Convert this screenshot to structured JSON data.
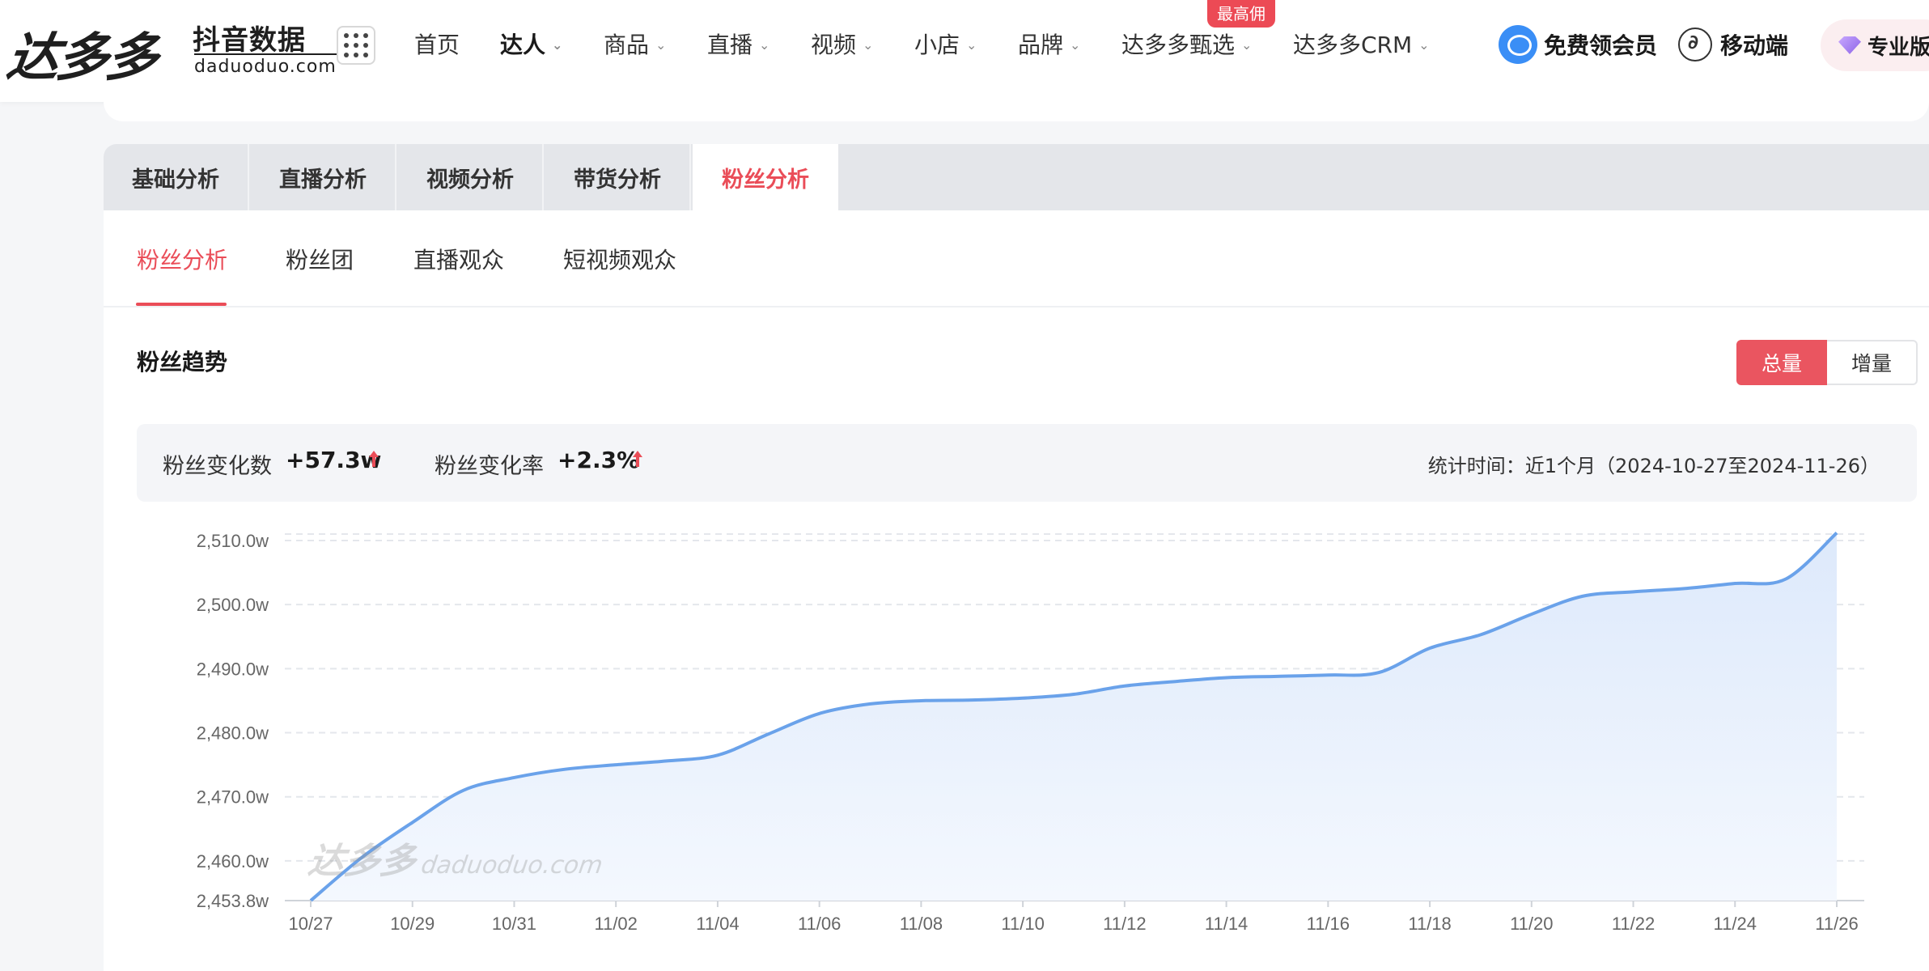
{
  "brand": {
    "logo_text": "达多多",
    "cn_sub": "抖音数据",
    "domain": "daduoduo.com"
  },
  "nav": {
    "items": [
      {
        "label": "首页",
        "dropdown": false
      },
      {
        "label": "达人",
        "dropdown": true,
        "active": true
      },
      {
        "label": "商品",
        "dropdown": true
      },
      {
        "label": "直播",
        "dropdown": true
      },
      {
        "label": "视频",
        "dropdown": true
      },
      {
        "label": "小店",
        "dropdown": true
      },
      {
        "label": "品牌",
        "dropdown": true
      },
      {
        "label": "达多多甄选",
        "dropdown": true
      },
      {
        "label": "达多多CRM",
        "dropdown": true
      }
    ],
    "badge": "最高佣",
    "vip_link": "免费领会员",
    "mobile_link": "移动端",
    "pro_label": "专业版"
  },
  "tabs": [
    {
      "label": "基础分析"
    },
    {
      "label": "直播分析"
    },
    {
      "label": "视频分析"
    },
    {
      "label": "带货分析"
    },
    {
      "label": "粉丝分析",
      "active": true
    }
  ],
  "subtabs": [
    {
      "label": "粉丝分析",
      "active": true
    },
    {
      "label": "粉丝团"
    },
    {
      "label": "直播观众"
    },
    {
      "label": "短视频观众"
    }
  ],
  "section": {
    "title": "粉丝趋势",
    "toggle_total": "总量",
    "toggle_increment": "增量",
    "selected": "总量"
  },
  "stats": {
    "change_label": "粉丝变化数",
    "change_value": "+57.3w",
    "rate_label": "粉丝变化率",
    "rate_value": "+2.3%",
    "time_label": "统计时间：近1个月（2024-10-27至2024-11-26）"
  },
  "watermark": {
    "cn": "达多多",
    "en": "daduoduo.com"
  },
  "colors": {
    "accent": "#ea4d58",
    "line": "#6aa2ea",
    "area_top": "#dde9fb",
    "area_bottom": "#f4f8fe"
  },
  "chart_data": {
    "type": "area",
    "x": [
      "10/27",
      "10/28",
      "10/29",
      "10/30",
      "10/31",
      "11/01",
      "11/02",
      "11/03",
      "11/04",
      "11/05",
      "11/06",
      "11/07",
      "11/08",
      "11/09",
      "11/10",
      "11/11",
      "11/12",
      "11/13",
      "11/14",
      "11/15",
      "11/16",
      "11/17",
      "11/18",
      "11/19",
      "11/20",
      "11/21",
      "11/22",
      "11/23",
      "11/24",
      "11/25",
      "11/26"
    ],
    "x_tick_labels": [
      "10/27",
      "10/29",
      "10/31",
      "11/02",
      "11/04",
      "11/06",
      "11/08",
      "11/10",
      "11/12",
      "11/14",
      "11/16",
      "11/18",
      "11/20",
      "11/22",
      "11/24",
      "11/26"
    ],
    "series": [
      {
        "values": [
          2453.8,
          2460.5,
          2466.0,
          2471.0,
          2473.0,
          2474.3,
          2475.0,
          2475.6,
          2476.5,
          2479.8,
          2483.0,
          2484.5,
          2485.0,
          2485.1,
          2485.4,
          2486.0,
          2487.3,
          2488.0,
          2488.6,
          2488.8,
          2489.0,
          2489.4,
          2493.2,
          2495.3,
          2498.5,
          2501.3,
          2502.0,
          2502.5,
          2503.3,
          2504.0,
          2511.2
        ]
      }
    ],
    "y_ticks": [
      "2,453.8w",
      "2,460.0w",
      "2,470.0w",
      "2,480.0w",
      "2,490.0w",
      "2,500.0w",
      "2,510.0w"
    ],
    "y_tick_values": [
      2453.8,
      2460,
      2470,
      2480,
      2490,
      2500,
      2510
    ],
    "ylim": [
      2453.8,
      2510
    ],
    "unit": "w",
    "grid": true,
    "legend": "none"
  }
}
